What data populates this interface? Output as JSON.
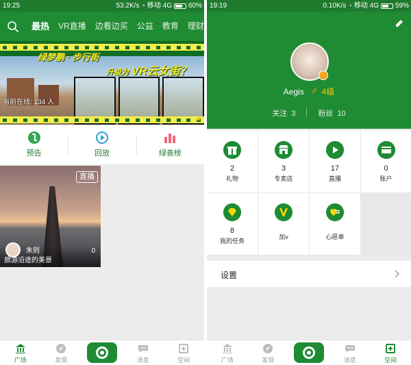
{
  "left_screen": {
    "status": {
      "time": "19:25",
      "speed": "53.2K/s",
      "carrier": "移动 4G",
      "battery": "60%",
      "battery_level": 0.6
    },
    "nav": {
      "tabs": [
        "最热",
        "VR直播",
        "边看边买",
        "公益",
        "教育",
        "理财"
      ],
      "active_tab": "最热"
    },
    "banner": {
      "title1": "绿梦鹏 · 步行街",
      "title2_prefix": "升级为",
      "title2_main": "VR云女街？",
      "online_label": "当前在线: 134 人"
    },
    "quick_actions": [
      {
        "label": "预告",
        "icon": "forecast-icon"
      },
      {
        "label": "回放",
        "icon": "replay-icon"
      },
      {
        "label": "绿善榜",
        "icon": "charity-chart-icon"
      }
    ],
    "live_card": {
      "badge": "直播",
      "author": "朱则",
      "title": "旅游沿途的美景",
      "viewers": "0"
    },
    "tabbar": [
      {
        "label": "广场",
        "icon": "home-icon",
        "active": true
      },
      {
        "label": "发现",
        "icon": "discover-icon",
        "active": false
      },
      {
        "label": "",
        "icon": "camera-icon",
        "active": false
      },
      {
        "label": "消息",
        "icon": "message-icon",
        "active": false
      },
      {
        "label": "空间",
        "icon": "space-icon",
        "active": false
      }
    ]
  },
  "right_screen": {
    "status": {
      "time": "19:19",
      "speed": "0.10K/s",
      "carrier": "移动 4G",
      "battery": "59%",
      "battery_level": 0.59
    },
    "profile": {
      "username": "Aegis",
      "gender_symbol": "♂",
      "level": "4级",
      "following_label": "关注",
      "following": "3",
      "fans_label": "粉丝",
      "fans": "10"
    },
    "grid": [
      {
        "count": "2",
        "label": "礼物",
        "icon": "gift-icon"
      },
      {
        "count": "3",
        "label": "专卖店",
        "icon": "shop-icon"
      },
      {
        "count": "17",
        "label": "直播",
        "icon": "play-icon"
      },
      {
        "count": "0",
        "label": "账户",
        "icon": "card-icon"
      },
      {
        "count": "8",
        "label": "我的任务",
        "icon": "diamond-icon"
      },
      {
        "count": "",
        "label": "加v",
        "icon": "v-icon"
      },
      {
        "count": "",
        "label": "心愿单",
        "icon": "wishlist-icon"
      }
    ],
    "settings_label": "设置",
    "tabbar": [
      {
        "label": "广场",
        "icon": "home-icon",
        "active": false
      },
      {
        "label": "发现",
        "icon": "discover-icon",
        "active": false
      },
      {
        "label": "",
        "icon": "camera-icon",
        "active": false
      },
      {
        "label": "消息",
        "icon": "message-icon",
        "active": false
      },
      {
        "label": "空间",
        "icon": "space-icon",
        "active": true
      }
    ]
  },
  "colors": {
    "brand_green": "#1f8b33",
    "status_green": "#1f7a2e",
    "accent_gold": "#f5c518"
  }
}
